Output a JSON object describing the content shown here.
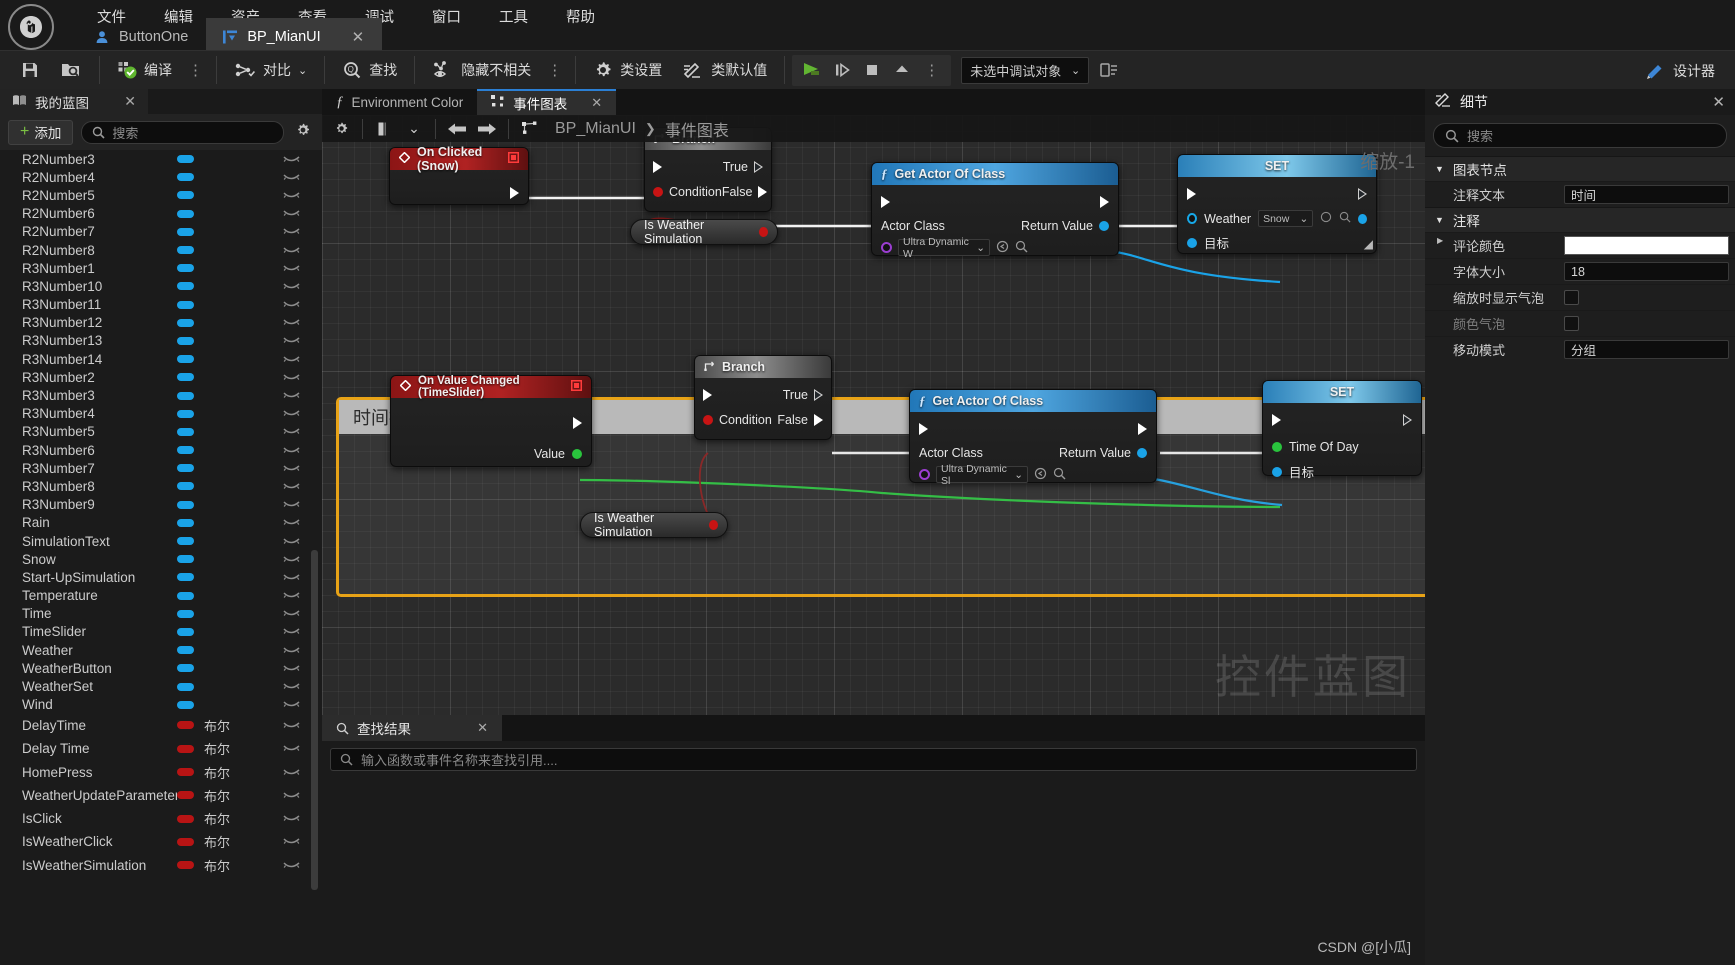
{
  "menu": {
    "items": [
      "文件",
      "编辑",
      "资产",
      "查看",
      "调试",
      "窗口",
      "工具",
      "帮助"
    ]
  },
  "doc_tabs": [
    {
      "label": "ButtonOne",
      "icon": "blueprint-actor-icon",
      "active": false
    },
    {
      "label": "BP_MianUI",
      "icon": "widget-blueprint-icon",
      "active": true,
      "close": "✕"
    }
  ],
  "toolbar": {
    "save_icon": "save-icon",
    "browse_icon": "browse-content-icon",
    "compile_label": "编译",
    "diff_label": "对比",
    "find_label": "查找",
    "hide_unrelated_label": "隐藏不相关",
    "class_settings_label": "类设置",
    "class_defaults_label": "类默认值",
    "dots": "⋮",
    "play_icon": "play-icon",
    "step_icon": "step-icon",
    "stop_icon": "stop-icon",
    "eject_icon": "eject-icon",
    "debug_object": "未选中调试对象",
    "debug_chevron": "⌄",
    "debug_extra_icon": "debug-filter-icon",
    "designer_label": "设计器"
  },
  "left_panel": {
    "tab_label": "我的蓝图",
    "tab_close": "✕",
    "add_label": "添加",
    "add_plus": "+",
    "search_placeholder": "搜索",
    "gear_icon": "gear-icon",
    "colors": {
      "object_pill": "#1aa3e8",
      "bool_pill": "#b81414"
    },
    "variables": [
      {
        "name": "R2Number3",
        "type": "",
        "kind": "object"
      },
      {
        "name": "R2Number4",
        "type": "",
        "kind": "object"
      },
      {
        "name": "R2Number5",
        "type": "",
        "kind": "object"
      },
      {
        "name": "R2Number6",
        "type": "",
        "kind": "object"
      },
      {
        "name": "R2Number7",
        "type": "",
        "kind": "object"
      },
      {
        "name": "R2Number8",
        "type": "",
        "kind": "object"
      },
      {
        "name": "R3Number1",
        "type": "",
        "kind": "object"
      },
      {
        "name": "R3Number10",
        "type": "",
        "kind": "object"
      },
      {
        "name": "R3Number11",
        "type": "",
        "kind": "object"
      },
      {
        "name": "R3Number12",
        "type": "",
        "kind": "object"
      },
      {
        "name": "R3Number13",
        "type": "",
        "kind": "object"
      },
      {
        "name": "R3Number14",
        "type": "",
        "kind": "object"
      },
      {
        "name": "R3Number2",
        "type": "",
        "kind": "object"
      },
      {
        "name": "R3Number3",
        "type": "",
        "kind": "object"
      },
      {
        "name": "R3Number4",
        "type": "",
        "kind": "object"
      },
      {
        "name": "R3Number5",
        "type": "",
        "kind": "object"
      },
      {
        "name": "R3Number6",
        "type": "",
        "kind": "object"
      },
      {
        "name": "R3Number7",
        "type": "",
        "kind": "object"
      },
      {
        "name": "R3Number8",
        "type": "",
        "kind": "object"
      },
      {
        "name": "R3Number9",
        "type": "",
        "kind": "object"
      },
      {
        "name": "Rain",
        "type": "",
        "kind": "object"
      },
      {
        "name": "SimulationText",
        "type": "",
        "kind": "object"
      },
      {
        "name": "Snow",
        "type": "",
        "kind": "object"
      },
      {
        "name": "Start-UpSimulation",
        "type": "",
        "kind": "object"
      },
      {
        "name": "Temperature",
        "type": "",
        "kind": "object"
      },
      {
        "name": "Time",
        "type": "",
        "kind": "object"
      },
      {
        "name": "TimeSlider",
        "type": "",
        "kind": "object"
      },
      {
        "name": "Weather",
        "type": "",
        "kind": "object"
      },
      {
        "name": "WeatherButton",
        "type": "",
        "kind": "object"
      },
      {
        "name": "WeatherSet",
        "type": "",
        "kind": "object"
      },
      {
        "name": "Wind",
        "type": "",
        "kind": "object"
      },
      {
        "name": "DelayTime",
        "type": "布尔",
        "kind": "bool"
      },
      {
        "name": "Delay Time",
        "type": "布尔",
        "kind": "bool"
      },
      {
        "name": "HomePress",
        "type": "布尔",
        "kind": "bool"
      },
      {
        "name": "WeatherUpdateParameter",
        "type": "布尔",
        "kind": "bool"
      },
      {
        "name": "IsClick",
        "type": "布尔",
        "kind": "bool"
      },
      {
        "name": "IsWeatherClick",
        "type": "布尔",
        "kind": "bool"
      },
      {
        "name": "IsWeatherSimulation",
        "type": "布尔",
        "kind": "bool"
      }
    ],
    "eye_icon": "eye-closed-icon"
  },
  "graph": {
    "tabs": [
      {
        "label": "Environment Color",
        "icon": "function-icon",
        "active": false
      },
      {
        "label": "事件图表",
        "icon": "event-graph-icon",
        "active": true,
        "close": "✕"
      }
    ],
    "toolbar": {
      "layout_icon": "layout-icon",
      "chevron": "⌄",
      "back_icon": "arrow-left-icon",
      "forward_icon": "arrow-right-icon",
      "graph_icon": "graph-icon"
    },
    "breadcrumb": {
      "root": "BP_MianUI",
      "separator": "❯",
      "leaf": "事件图表"
    },
    "zoom_label": "缩放-1",
    "watermark": "控件蓝图",
    "comment": {
      "title": "时间控制",
      "border_color": "#e8a317"
    },
    "nodes": [
      {
        "id": "on-clicked-snow",
        "title": "On Clicked (Snow)",
        "kind": "event",
        "outputs": [
          "exec"
        ]
      },
      {
        "id": "branch-top",
        "title": "Branch",
        "kind": "flow",
        "pins": {
          "condition": "Condition",
          "true": "True",
          "false": "False"
        }
      },
      {
        "id": "is-weather-simulation-top",
        "title": "Is Weather Simulation",
        "kind": "variable-get"
      },
      {
        "id": "get-actor-of-class-top",
        "title": "Get Actor Of Class",
        "kind": "function",
        "pins": {
          "actor_class": "Actor Class",
          "return_value": "Return Value"
        },
        "class_value": "Ultra Dynamic W"
      },
      {
        "id": "set-weather",
        "title": "SET",
        "kind": "set",
        "pins": {
          "prop": "Weather",
          "target": "目标"
        },
        "prop_value": "Snow"
      },
      {
        "id": "on-value-changed-timeslider",
        "title": "On Value Changed (TimeSlider)",
        "kind": "event",
        "pins": {
          "value": "Value"
        }
      },
      {
        "id": "branch-bottom",
        "title": "Branch",
        "kind": "flow",
        "pins": {
          "condition": "Condition",
          "true": "True",
          "false": "False"
        }
      },
      {
        "id": "is-weather-simulation-bottom",
        "title": "Is Weather Simulation",
        "kind": "variable-get"
      },
      {
        "id": "get-actor-of-class-bottom",
        "title": "Get Actor Of Class",
        "kind": "function",
        "pins": {
          "actor_class": "Actor Class",
          "return_value": "Return Value"
        },
        "class_value": "Ultra Dynamic Sl"
      },
      {
        "id": "set-time-of-day",
        "title": "SET",
        "kind": "set",
        "pins": {
          "prop": "Time Of Day",
          "target": "目标"
        }
      }
    ]
  },
  "find_panel": {
    "tab_label": "查找结果",
    "tab_close": "✕",
    "search_placeholder": "输入函数或事件名称来查找引用....",
    "search_icon": "search-icon"
  },
  "details_panel": {
    "title": "细节",
    "title_icon": "details-icon",
    "close": "✕",
    "search_placeholder": "搜索",
    "sections": [
      {
        "label": "图表节点",
        "expanded": true,
        "rows": [
          {
            "label": "注释文本",
            "type": "text",
            "value": "时间"
          }
        ]
      },
      {
        "label": "注释",
        "expanded": true,
        "rows": [
          {
            "label": "评论颜色",
            "type": "color",
            "value": "#ffffff",
            "has_arrow": true
          },
          {
            "label": "字体大小",
            "type": "number",
            "value": "18"
          },
          {
            "label": "缩放时显示气泡",
            "type": "checkbox",
            "value": ""
          },
          {
            "label": "颜色气泡",
            "type": "checkbox",
            "value": "",
            "dim": true
          },
          {
            "label": "移动模式",
            "type": "select",
            "value": "分组"
          }
        ]
      }
    ]
  },
  "credit": "CSDN @[小瓜]"
}
